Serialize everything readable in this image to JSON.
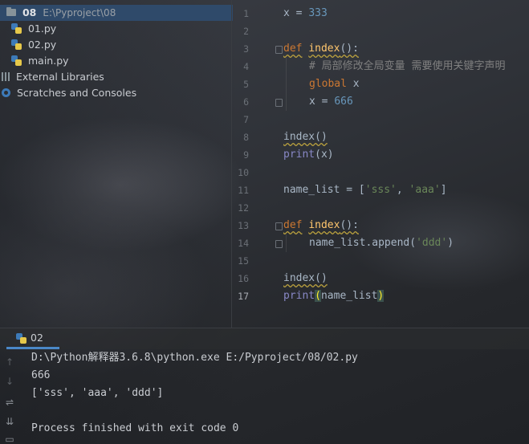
{
  "project_tree": {
    "root_name": "08",
    "root_path": "E:\\Pyproject\\08",
    "files": [
      "01.py",
      "02.py",
      "main.py"
    ],
    "external_libraries": "External Libraries",
    "scratches": "Scratches and Consoles"
  },
  "editor": {
    "line_numbers": [
      "1",
      "2",
      "3",
      "4",
      "5",
      "6",
      "7",
      "8",
      "9",
      "10",
      "11",
      "12",
      "13",
      "14",
      "15",
      "16",
      "17"
    ],
    "current_line": "17",
    "lines": {
      "l1_a": "x = ",
      "l1_num": "333",
      "l3_def": "def",
      "l3_name": "index",
      "l3_rest": "():",
      "l4_comment": "# 局部修改全局变量 需要使用关键字声明",
      "l5_kw": "global",
      "l5_rest": " x",
      "l6_a": "x = ",
      "l6_num": "666",
      "l8": "index()",
      "l9_print": "print",
      "l9_rest": "(x)",
      "l11_a": "name_list = [",
      "l11_s1": "'sss'",
      "l11_comma": ", ",
      "l11_s2": "'aaa'",
      "l11_end": "]",
      "l13_def": "def",
      "l13_name": "index",
      "l13_rest": "():",
      "l14_a": "name_list.append(",
      "l14_s": "'ddd'",
      "l14_end": ")",
      "l16": "index()",
      "l17_print": "print",
      "l17_open": "(",
      "l17_mid": "name_list",
      "l17_close": ")"
    }
  },
  "run_panel": {
    "tab_label": "02",
    "output": [
      "D:\\Python解释器3.6.8\\python.exe E:/Pyproject/08/02.py",
      "666",
      "['sss', 'aaa', 'ddd']",
      "",
      "Process finished with exit code 0"
    ]
  },
  "colors": {
    "keyword": "#cc7832",
    "function": "#ffc66d",
    "number": "#6897bb",
    "string": "#6a8759",
    "builtin": "#8888c6",
    "comment": "#808080",
    "selection": "#2f4a6a",
    "tab_accent": "#4a88c7"
  },
  "icons": {
    "folder": "folder-icon",
    "python_file": "python-file-icon",
    "libraries": "libraries-icon",
    "scratches": "scratches-icon",
    "rerun": "rerun-icon",
    "down": "arrow-down-icon",
    "wrap": "soft-wrap-icon",
    "sort": "scroll-to-end-icon"
  }
}
